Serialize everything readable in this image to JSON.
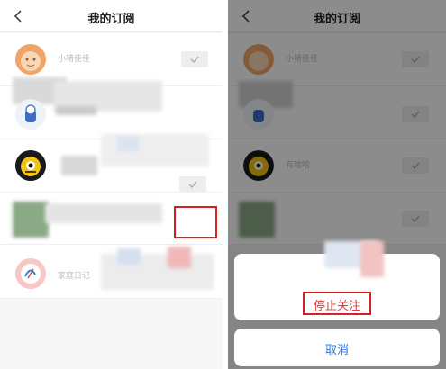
{
  "left_screen": {
    "header": {
      "title": "我的订阅",
      "back_icon": "chevron-left-icon"
    },
    "subscriptions": [
      {
        "name": "小猪佳佳",
        "avatar": "orange-cartoon-avatar",
        "subscribed": true
      },
      {
        "name": "",
        "avatar": "blue-cartoon-avatar",
        "subscribed": false
      },
      {
        "name": "",
        "avatar": "yellow-monster-avatar",
        "subscribed": false
      },
      {
        "name": "",
        "avatar": "green-blurred-avatar",
        "subscribed": true
      },
      {
        "name": "家庭日记",
        "avatar": "pink-circle-avatar",
        "subscribed": false
      }
    ]
  },
  "right_screen": {
    "header": {
      "title": "我的订阅",
      "back_icon": "chevron-left-icon"
    },
    "subscriptions": [
      {
        "name": "小猪佳佳",
        "subscribed": true
      },
      {
        "name": "",
        "subscribed": true
      },
      {
        "name": "有哈哈",
        "subscribed": true
      },
      {
        "name": "",
        "subscribed": true
      }
    ],
    "action_sheet": {
      "stop_follow_label": "停止关注",
      "cancel_label": "取消"
    }
  },
  "colors": {
    "highlight": "#d42222",
    "cancel_text": "#2d78e6",
    "stop_text": "#e03a3a"
  }
}
